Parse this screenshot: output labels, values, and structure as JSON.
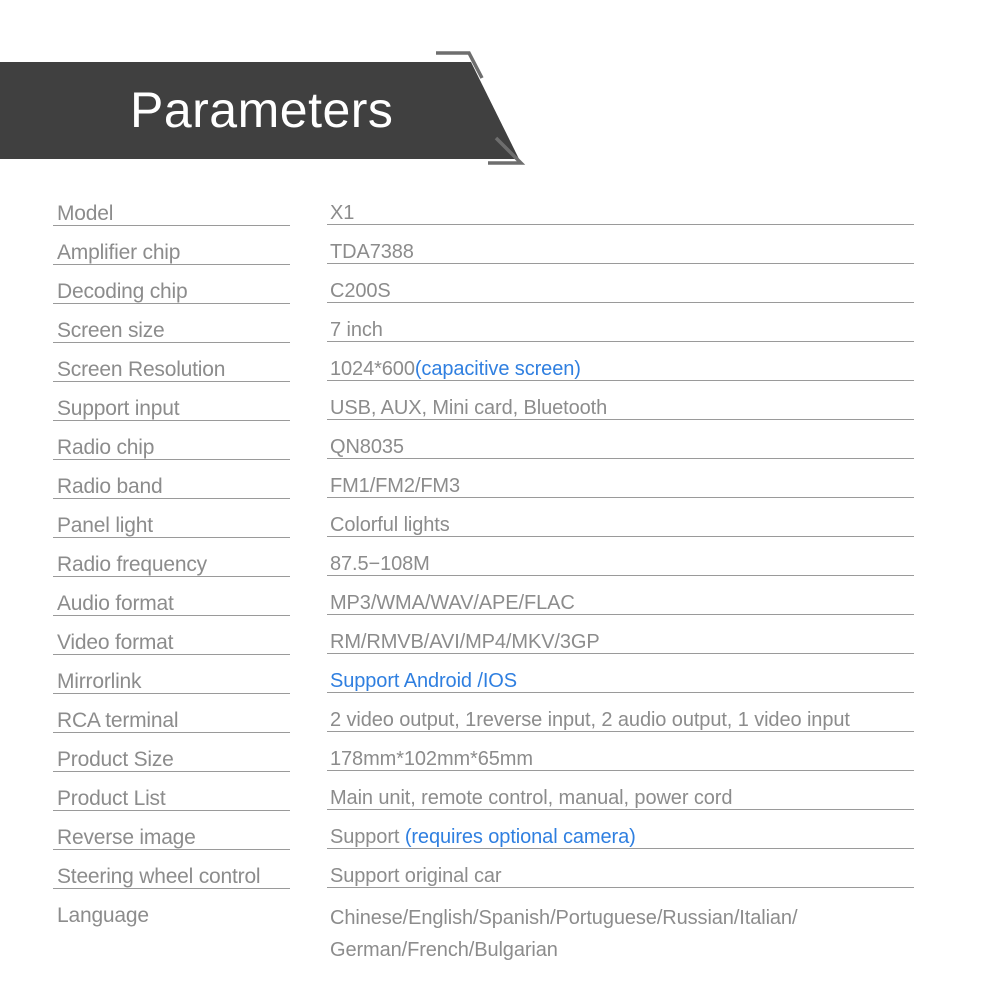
{
  "banner": {
    "title": "Parameters",
    "background_color": "#404040",
    "title_color": "#ffffff",
    "accent_color": "#6e6e6e"
  },
  "theme": {
    "label_color": "#8c8c8c",
    "value_color": "#8c8c8c",
    "accent_blue": "#2f7fe0",
    "rule_color": "#9a9a9a"
  },
  "spec_table": {
    "rows": [
      {
        "label": "Model",
        "value": "X1"
      },
      {
        "label": "Amplifier chip",
        "value": "TDA7388"
      },
      {
        "label": "Decoding chip",
        "value": "C200S"
      },
      {
        "label": "Screen size",
        "value": "7 inch"
      },
      {
        "label": "Screen Resolution",
        "value": "1024*600",
        "value_blue": "(capacitive screen)"
      },
      {
        "label": "Support input",
        "value": "USB, AUX, Mini card, Bluetooth"
      },
      {
        "label": "Radio chip",
        "value": "QN8035"
      },
      {
        "label": "Radio band",
        "value": "FM1/FM2/FM3"
      },
      {
        "label": "Panel light",
        "value": "Colorful lights"
      },
      {
        "label": "Radio frequency",
        "value": "87.5−108M"
      },
      {
        "label": "Audio format",
        "value": "MP3/WMA/WAV/APE/FLAC"
      },
      {
        "label": "Video format",
        "value": "RM/RMVB/AVI/MP4/MKV/3GP"
      },
      {
        "label": "Mirrorlink",
        "value": "",
        "value_blue": "Support Android /IOS"
      },
      {
        "label": "RCA terminal",
        "value": "2 video output, 1reverse input, 2 audio output, 1 video input"
      },
      {
        "label": "Product Size",
        "value": "178mm*102mm*65mm"
      },
      {
        "label": "Product List",
        "value": "Main unit, remote control, manual, power cord"
      },
      {
        "label": "Reverse image",
        "value": "Support ",
        "value_blue": "(requires optional camera)"
      },
      {
        "label": "Steering wheel control",
        "value": "Support original car"
      },
      {
        "label": "Language",
        "value_line1": "Chinese/English/Spanish/Portuguese/Russian/Italian/",
        "value_line2": "German/French/Bulgarian"
      }
    ]
  }
}
